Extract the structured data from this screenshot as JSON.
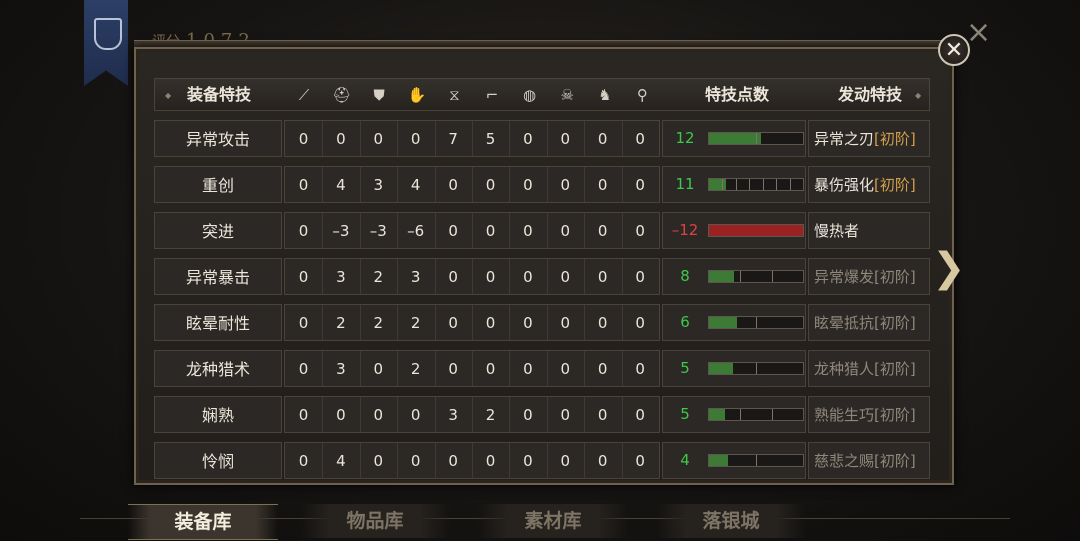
{
  "score": {
    "label": "评分",
    "value": "1072"
  },
  "header": {
    "col_name": "装备特技",
    "col_points": "特技点数",
    "col_skill": "发动特技",
    "equip_icons": [
      "sword-icon",
      "helmet-icon",
      "chest-armor-icon",
      "gauntlet-icon",
      "waist-icon",
      "boots-icon",
      "charm-icon",
      "beast-mask-icon",
      "horse-icon",
      "hook-icon"
    ]
  },
  "colors": {
    "positive": "#3fc84a",
    "negative": "#e04141",
    "bar_green": "#3d7a36",
    "bar_red": "#9b2222",
    "tier": "#d1a04a"
  },
  "rows": [
    {
      "name": "异常攻击",
      "vals": [
        "0",
        "0",
        "0",
        "0",
        "7",
        "5",
        "0",
        "0",
        "0",
        "0"
      ],
      "points": "12",
      "fill": 0.55,
      "segments": 2,
      "neg": false,
      "skill": "异常之刃",
      "tier": "[初阶]",
      "active": true
    },
    {
      "name": "重创",
      "vals": [
        "0",
        "4",
        "3",
        "4",
        "0",
        "0",
        "0",
        "0",
        "0",
        "0"
      ],
      "points": "11",
      "fill": 0.18,
      "segments": 7,
      "neg": false,
      "skill": "暴伤强化",
      "tier": "[初阶]",
      "active": true
    },
    {
      "name": "突进",
      "vals": [
        "0",
        "–3",
        "–3",
        "–6",
        "0",
        "0",
        "0",
        "0",
        "0",
        "0"
      ],
      "points": "–12",
      "fill": 1.0,
      "segments": 1,
      "neg": true,
      "skill": "慢热者",
      "tier": "",
      "active": true
    },
    {
      "name": "异常暴击",
      "vals": [
        "0",
        "3",
        "2",
        "3",
        "0",
        "0",
        "0",
        "0",
        "0",
        "0"
      ],
      "points": "8",
      "fill": 0.27,
      "segments": 3,
      "neg": false,
      "skill": "异常爆发",
      "tier": "[初阶]",
      "active": false
    },
    {
      "name": "眩晕耐性",
      "vals": [
        "0",
        "2",
        "2",
        "2",
        "0",
        "0",
        "0",
        "0",
        "0",
        "0"
      ],
      "points": "6",
      "fill": 0.3,
      "segments": 2,
      "neg": false,
      "skill": "眩晕抵抗",
      "tier": "[初阶]",
      "active": false
    },
    {
      "name": "龙种猎术",
      "vals": [
        "0",
        "3",
        "0",
        "2",
        "0",
        "0",
        "0",
        "0",
        "0",
        "0"
      ],
      "points": "5",
      "fill": 0.25,
      "segments": 2,
      "neg": false,
      "skill": "龙种猎人",
      "tier": "[初阶]",
      "active": false
    },
    {
      "name": "娴熟",
      "vals": [
        "0",
        "0",
        "0",
        "0",
        "3",
        "2",
        "0",
        "0",
        "0",
        "0"
      ],
      "points": "5",
      "fill": 0.17,
      "segments": 3,
      "neg": false,
      "skill": "熟能生巧",
      "tier": "[初阶]",
      "active": false
    },
    {
      "name": "怜悯",
      "vals": [
        "0",
        "4",
        "0",
        "0",
        "0",
        "0",
        "0",
        "0",
        "0",
        "0"
      ],
      "points": "4",
      "fill": 0.2,
      "segments": 2,
      "neg": false,
      "skill": "慈悲之赐",
      "tier": "[初阶]",
      "active": false
    }
  ],
  "tabs": [
    "装备库",
    "物品库",
    "素材库",
    "落银城"
  ],
  "active_tab": "装备库"
}
